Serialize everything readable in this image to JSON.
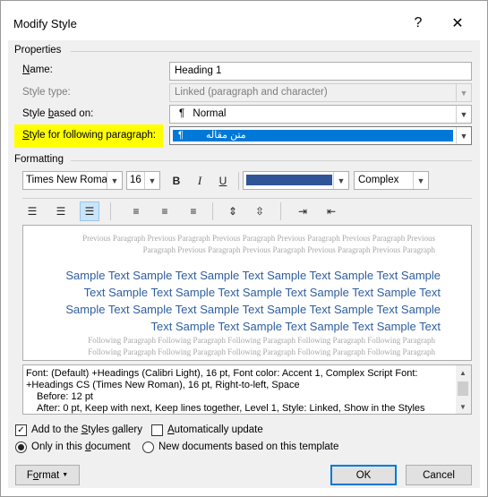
{
  "window": {
    "title": "Modify Style",
    "help_glyph": "?",
    "close_glyph": "✕"
  },
  "properties": {
    "heading": "Properties",
    "name_label": "Name:",
    "name_value": "Heading 1",
    "style_type_label": "Style type:",
    "style_type_value": "Linked (paragraph and character)",
    "based_on_label": "Style based on:",
    "based_on_value": "Normal",
    "based_on_icon_glyph": "¶",
    "following_label": "Style for following paragraph:",
    "following_value": "متن مقاله",
    "following_icon_glyph": "¶"
  },
  "formatting": {
    "heading": "Formatting",
    "font": "Times New Roman",
    "size": "16",
    "bold": "B",
    "italic": "I",
    "underline": "U",
    "script": "Complex",
    "font_color": "#2f5597"
  },
  "toolbar": {
    "align_icons": [
      "align-left-icon",
      "align-center-icon",
      "align-right-icon"
    ],
    "spacing_icons": [
      "single-spacing-icon",
      "one-half-spacing-icon",
      "double-spacing-icon"
    ],
    "paragraph_spacing_icons": [
      "increase-spacing-icon",
      "decrease-spacing-icon"
    ],
    "indent_icons": [
      "decrease-indent-icon",
      "increase-indent-icon"
    ],
    "active": "align-right"
  },
  "preview": {
    "previous_lines": [
      "Previous Paragraph Previous Paragraph Previous Paragraph Previous Paragraph Previous Paragraph Previous",
      "Paragraph Previous Paragraph Previous Paragraph Previous Paragraph Previous Paragraph"
    ],
    "sample_lines": [
      "Sample Text Sample Text Sample Text Sample Text Sample Text Sample",
      "Text Sample Text Sample Text Sample Text Sample Text Sample Text",
      "Sample Text Sample Text Sample Text Sample Text Sample Text Sample",
      "Text Sample Text Sample Text Sample Text Sample Text"
    ],
    "following_lines": [
      "Following Paragraph Following Paragraph Following Paragraph Following Paragraph Following Paragraph",
      "Following Paragraph Following Paragraph Following Paragraph Following Paragraph Following Paragraph"
    ]
  },
  "description": {
    "lines": [
      "Font: (Default) +Headings (Calibri Light), 16 pt, Font color: Accent 1, Complex Script Font:",
      "+Headings CS (Times New Roman), 16 pt, Right-to-left, Space",
      "Before:  12 pt",
      "After:  0 pt, Keep with next, Keep lines together, Level 1, Style: Linked, Show in the Styles"
    ]
  },
  "options": {
    "add_to_gallery": "Add to the Styles gallery",
    "add_to_gallery_checked": true,
    "auto_update": "Automatically update",
    "auto_update_checked": false,
    "only_this_doc": "Only in this document",
    "new_docs": "New documents based on this template",
    "selected_scope": "only_this_doc"
  },
  "buttons": {
    "format": "Format",
    "ok": "OK",
    "cancel": "Cancel"
  }
}
